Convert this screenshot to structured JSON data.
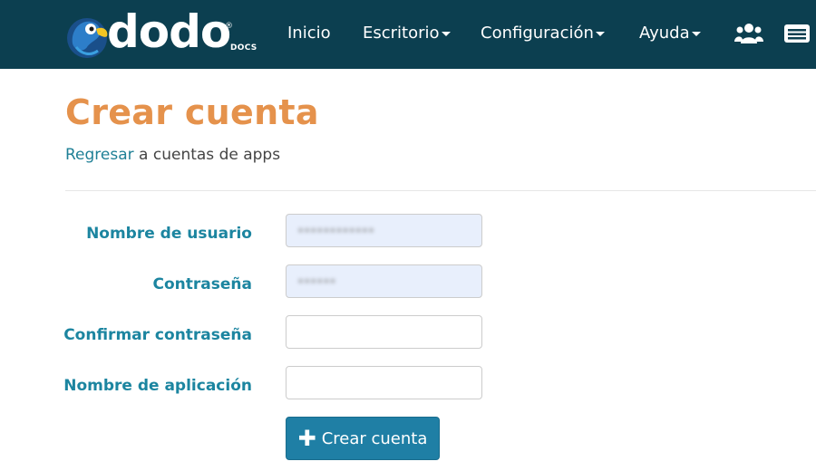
{
  "navbar": {
    "logo": {
      "word": "dodo",
      "reg": "®",
      "sub": "DOCS"
    },
    "items": [
      {
        "label": "Inicio",
        "dropdown": false
      },
      {
        "label": "Escritorio",
        "dropdown": true
      },
      {
        "label": "Configuración",
        "dropdown": true
      },
      {
        "label": "Ayuda",
        "dropdown": true
      }
    ],
    "icons": [
      "users-icon",
      "id-card-icon"
    ],
    "background": "#0c3f50"
  },
  "page": {
    "title": "Crear cuenta",
    "breadcrumb": {
      "link": "Regresar",
      "rest": " a cuentas de apps"
    }
  },
  "form": {
    "fields": [
      {
        "label": "Nombre de usuario",
        "value": "••••••••••••",
        "autofilled": true
      },
      {
        "label": "Contraseña",
        "value": "••••••",
        "autofilled": true
      },
      {
        "label": "Confirmar contraseña",
        "value": "",
        "autofilled": false
      },
      {
        "label": "Nombre de aplicación",
        "value": "",
        "autofilled": false
      }
    ],
    "submit_label": "Crear cuenta"
  },
  "colors": {
    "title": "#e5924c",
    "label": "#1c85a0",
    "link": "#1f8096",
    "button": "#1f7fa5"
  }
}
